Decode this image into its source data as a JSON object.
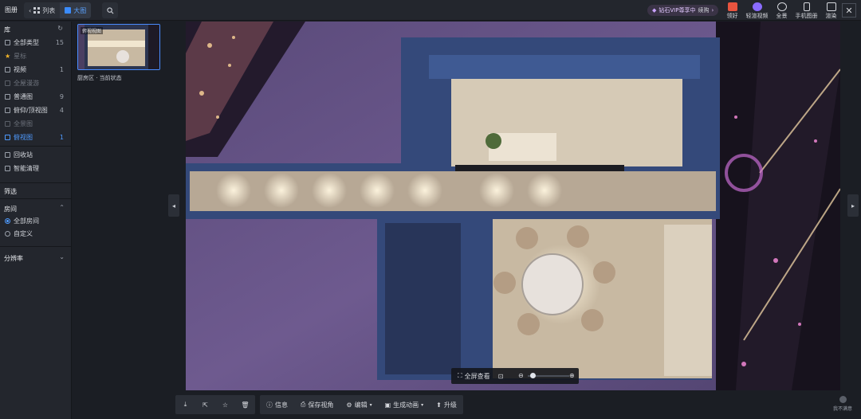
{
  "header": {
    "title": "图册",
    "tab_list": "列表",
    "tab_big": "大图",
    "vip_text": "钻石VIP尊享中",
    "vip_link": "续购",
    "actions": [
      {
        "label": "领好",
        "icon": "gift-icon",
        "color": "#e8543f"
      },
      {
        "label": "轻渲视频",
        "icon": "video-icon",
        "color": "#8a6cff"
      },
      {
        "label": "全景",
        "icon": "panorama-icon",
        "color": "#d6d8dd"
      },
      {
        "label": "手机图册",
        "icon": "phone-icon",
        "color": "#d6d8dd"
      },
      {
        "label": "渲染",
        "icon": "camera-icon",
        "color": "#d6d8dd"
      }
    ]
  },
  "sidebar": {
    "library_title": "库",
    "items": [
      {
        "label": "全部类型",
        "count": "15",
        "state": "normal",
        "icon": "all-types-icon"
      },
      {
        "label": "星标",
        "count": "",
        "state": "dim",
        "icon": "star-icon"
      },
      {
        "label": "视频",
        "count": "1",
        "state": "normal",
        "icon": "video-icon"
      },
      {
        "label": "全屋漫游",
        "count": "",
        "state": "dim",
        "icon": "tour-icon"
      },
      {
        "label": "普通图",
        "count": "9",
        "state": "normal",
        "icon": "image-icon"
      },
      {
        "label": "俯仰/顶视图",
        "count": "4",
        "state": "normal",
        "icon": "perspective-icon"
      },
      {
        "label": "全景图",
        "count": "",
        "state": "dim",
        "icon": "panorama-icon"
      },
      {
        "label": "俯视图",
        "count": "1",
        "state": "active",
        "icon": "top-view-icon"
      }
    ],
    "recycle": "回收站",
    "cleanup": "智能清理",
    "filter_title": "筛选",
    "room_title": "房间",
    "room_options": [
      "全部房间",
      "自定义"
    ],
    "resolution_title": "分辨率"
  },
  "thumbnails": [
    {
      "tag": "俯视视图",
      "label": "厨房区 · 当前状态"
    }
  ],
  "viewer": {
    "fullscreen_label": "全屏查看",
    "zoom_level": 0.05
  },
  "toolbar": {
    "info": "信息",
    "save_view": "保存视角",
    "edit": "编辑",
    "generate_animation": "生成动画",
    "upgrade": "升级"
  },
  "feedback": "我不满意",
  "colors": {
    "accent": "#4f9bff",
    "wall": "#34497a",
    "floor": "#d8cebf",
    "background": "#5b4c7d"
  }
}
